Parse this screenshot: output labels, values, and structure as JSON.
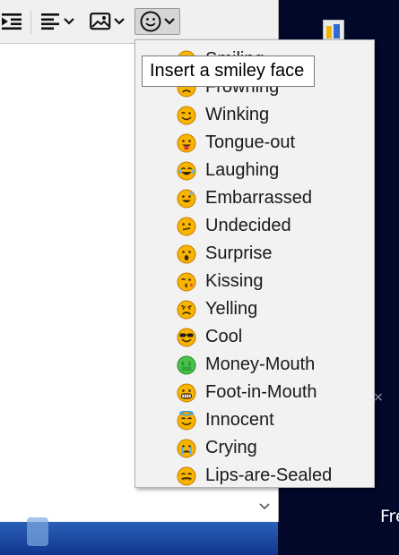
{
  "toolbar": {
    "buttons": [
      {
        "name": "indent-icon"
      },
      {
        "name": "align-icon"
      },
      {
        "name": "image-icon"
      },
      {
        "name": "smiley-icon"
      }
    ]
  },
  "tooltip": {
    "text": "Insert a smiley face"
  },
  "menu": {
    "items": [
      {
        "label": "Smiling",
        "icon": "smiling-face"
      },
      {
        "label": "Frowning",
        "icon": "frowning-face"
      },
      {
        "label": "Winking",
        "icon": "winking-face"
      },
      {
        "label": "Tongue-out",
        "icon": "tongue-out-face"
      },
      {
        "label": "Laughing",
        "icon": "laughing-face"
      },
      {
        "label": "Embarrassed",
        "icon": "embarrassed-face"
      },
      {
        "label": "Undecided",
        "icon": "undecided-face"
      },
      {
        "label": "Surprise",
        "icon": "surprise-face"
      },
      {
        "label": "Kissing",
        "icon": "kissing-face"
      },
      {
        "label": "Yelling",
        "icon": "yelling-face"
      },
      {
        "label": "Cool",
        "icon": "cool-face"
      },
      {
        "label": "Money-Mouth",
        "icon": "money-mouth-face"
      },
      {
        "label": "Foot-in-Mouth",
        "icon": "foot-in-mouth-face"
      },
      {
        "label": "Innocent",
        "icon": "innocent-face"
      },
      {
        "label": "Crying",
        "icon": "crying-face"
      },
      {
        "label": "Lips-are-Sealed",
        "icon": "lips-are-sealed-face"
      }
    ]
  },
  "desktop": {
    "text": "Fre"
  },
  "colors": {
    "emoji_yellow": "#f7b500",
    "emoji_outline": "#c77800"
  }
}
